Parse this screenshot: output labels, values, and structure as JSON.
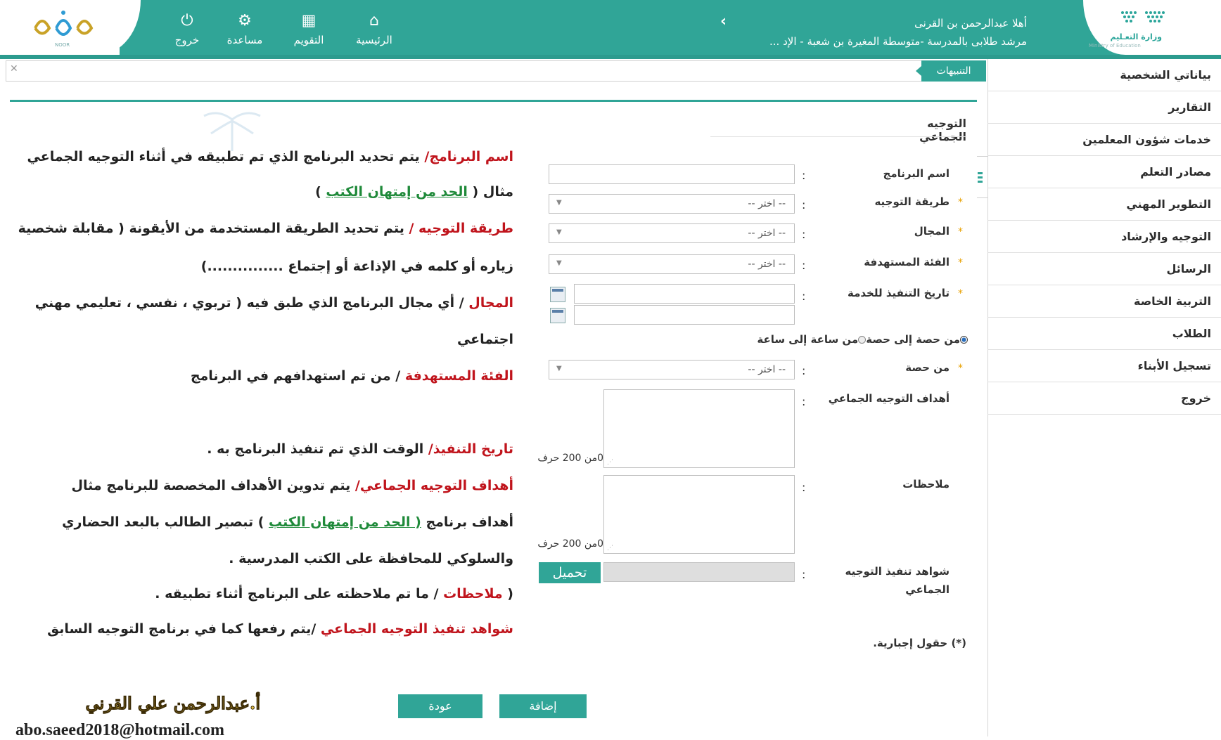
{
  "header": {
    "noor_logo_text": "NOOR",
    "moe_logo_text": "وزارة التعـليم",
    "moe_logo_sub": "Ministry of Education",
    "nav": [
      {
        "label": "خروج",
        "icon": "power-icon"
      },
      {
        "label": "مساعدة",
        "icon": "gear-icon"
      },
      {
        "label": "التقويم",
        "icon": "calendar-icon"
      },
      {
        "label": "الرئيسية",
        "icon": "home-icon"
      }
    ],
    "collapse_arrow": "‹",
    "welcome_line1": "أهلا عبدالرحمن بن القرنى",
    "welcome_line2": "مرشد طلابى بالمدرسة -متوسطة المغيرة بن شعبة - الإد ..."
  },
  "notifications": {
    "tab_label": "التنبيهات",
    "close_glyph": "✕"
  },
  "sidebar": {
    "items": [
      {
        "label": "بياناتي الشخصية"
      },
      {
        "label": "التقارير"
      },
      {
        "label": "خدمات شؤون المعلمين"
      },
      {
        "label": "مصادر التعلم"
      },
      {
        "label": "التطوير المهني"
      },
      {
        "label": "التوجيه والإرشاد"
      },
      {
        "label": "الرسائل"
      },
      {
        "label": "التربية الخاصة"
      },
      {
        "label": "الطلاب"
      },
      {
        "label": "تسجيل الأبناء"
      },
      {
        "label": "خروج"
      }
    ]
  },
  "form": {
    "title": "التوجيه الجماعي",
    "program_name_label": "اسم البرنامج",
    "method_label": "طريقة التوجيه",
    "field_label": "المجال",
    "target_label": "الفئة المستهدفة",
    "date_label": "تاريخ التنفيذ للخدمة",
    "select_placeholder": "-- اختر --",
    "radio_period": "من حصة إلى حصة",
    "radio_hour": "من ساعة إلى ساعة",
    "from_period_label": "من حصة",
    "goals_label": "أهداف التوجيه الجماعي",
    "notes_label": "ملاحظات",
    "counter": "0من 200 حرف",
    "evidence_label": "شواهد تنفيذ التوجيه الجماعي",
    "upload_label": "تحميل",
    "required_note": "(*) حقول إجبارية.",
    "required_mark": "*",
    "colon": ":",
    "add_button": "إضافة",
    "back_button": "عودة"
  },
  "overlay": {
    "l1_red": "اسم البرنامج/",
    "l1_text": " يتم تحديد البرنامج الذي تم تطبيقه في أثناء التوجيه الجماعي",
    "l2_pre": "مثال ( ",
    "l2_link": "الحد من إمتهان الكتب",
    "l2_post": " )",
    "l3_red": "طريقة التوجيه /",
    "l3_text": " يتم تحديد الطريقة المستخدمة من الأيقونة ( مقابلة شخصية",
    "l4_text": "زياره أو كلمه في الإذاعة أو إجتماع ...............)",
    "l5_red": "المجال",
    "l5_text": " / أي مجال البرنامج الذي طبق فيه ( تربوي ، نفسي ، تعليمي مهني",
    "l6_text": "اجتماعي",
    "l7_red": "الفئة المستهدفة",
    "l7_text": " / من تم استهدافهم في البرنامج",
    "l8_red": "تاريخ التنفيذ/",
    "l8_text": " الوقت الذي تم تنفيذ البرنامج به .",
    "l9_red": "أهداف التوجيه الجماعي/",
    "l9_text": "  يتم تدوين الأهداف المخصصة للبرنامج  مثال",
    "l10_pre": "أهداف  برنامج ",
    "l10_link": "( الحد من إمتهان الكتب",
    "l10_post": " )   تبصير الطالب بالبعد الحضاري",
    "l11_text": "والسلوكي للمحافظة على الكتب المدرسية .",
    "l12_pre": "(  ",
    "l12_red": "ملاحظات",
    "l12_text": " / ما تم ملاحظته على البرنامج أثناء تطبيقه .",
    "l13_red": "شواهد تنفيذ التوجيه الجماعي",
    "l13_text": " /يتم رفعها كما في برنامج التوجيه السابق",
    "signature_name": "أ.عبدالرحمن علي القرني",
    "signature_email": "abo.saeed2018@hotmail.com"
  }
}
